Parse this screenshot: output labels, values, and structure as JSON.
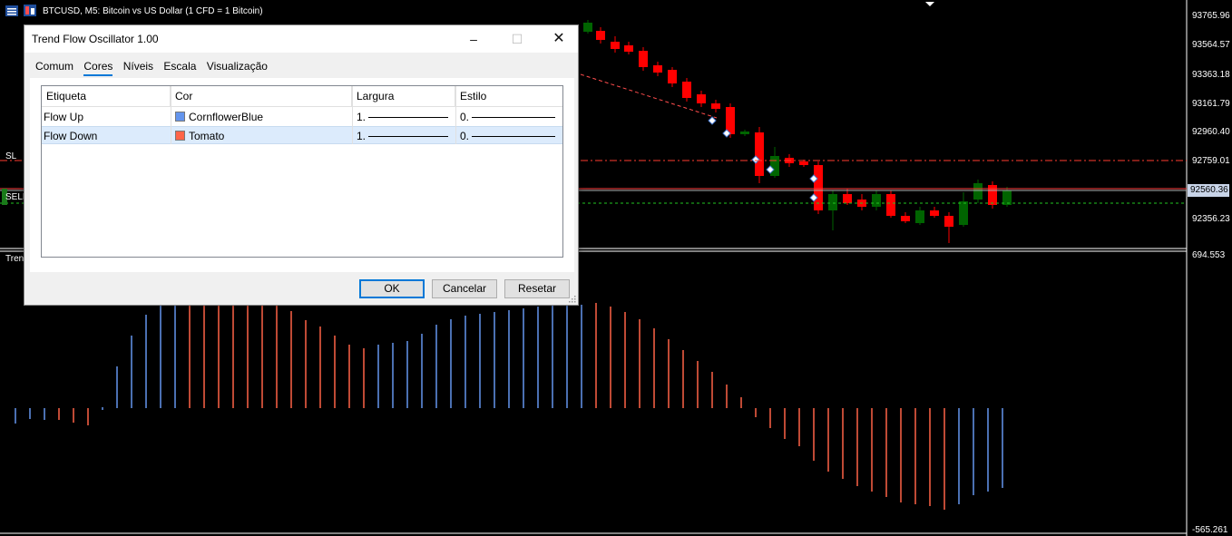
{
  "window": {
    "symbol_title": "BTCUSD, M5:  Bitcoin vs US Dollar (1 CFD = 1 Bitcoin)"
  },
  "chart": {
    "price_labels": [
      "93765.96",
      "93564.57",
      "93363.18",
      "93161.79",
      "92960.40",
      "92759.01",
      "92560.36",
      "92356.23"
    ],
    "current_price": "92560.36",
    "sl_label": "SL",
    "sell_label": "SELL",
    "indicator_label": "Trend",
    "osc_top": "694.553",
    "osc_bottom": "-565.261",
    "colors": {
      "up": "#ff0000",
      "down": "#006400",
      "flow_up": "#6495ed",
      "flow_down": "#ff6347"
    }
  },
  "dialog": {
    "title": "Trend Flow Oscillator 1.00",
    "tabs": [
      "Comum",
      "Cores",
      "Níveis",
      "Escala",
      "Visualização"
    ],
    "active_tab": "Cores",
    "columns": [
      "Etiqueta",
      "Cor",
      "Largura",
      "Estilo"
    ],
    "rows": [
      {
        "label": "Flow Up",
        "color_name": "CornflowerBlue",
        "color": "#6495ed",
        "width": "1.",
        "style": "0."
      },
      {
        "label": "Flow Down",
        "color_name": "Tomato",
        "color": "#ff6347",
        "width": "1.",
        "style": "0."
      }
    ],
    "buttons": {
      "ok": "OK",
      "cancel": "Cancelar",
      "reset": "Resetar"
    }
  }
}
